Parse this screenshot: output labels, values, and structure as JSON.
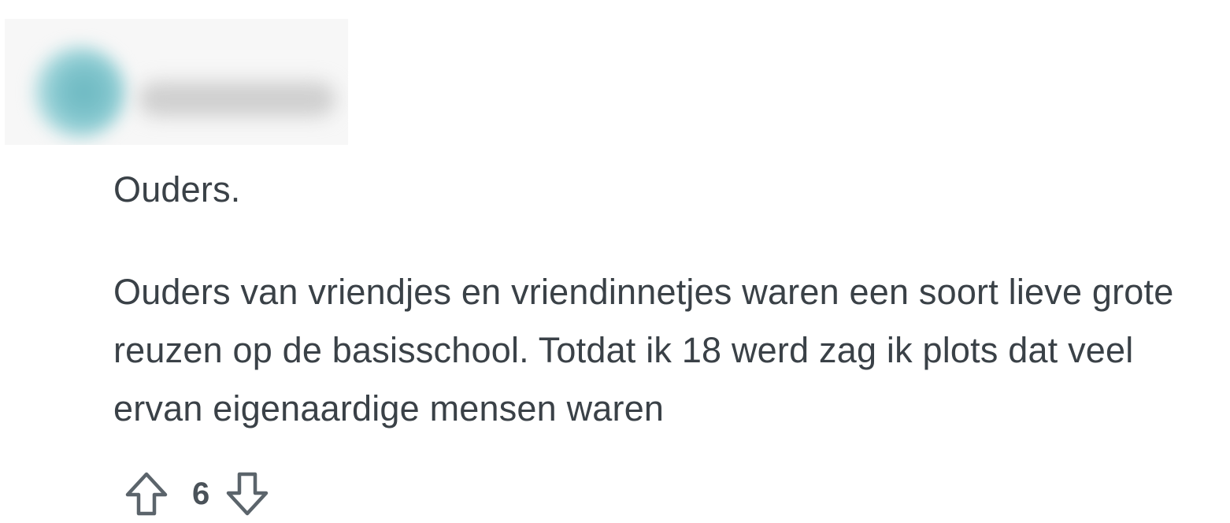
{
  "author": {
    "avatar": "blurred-avatar",
    "username": ""
  },
  "comment": {
    "paragraphs": [
      "Ouders.",
      "Ouders van vriendjes en vriendinnetjes waren een soort lieve grote reuzen op de basisschool. Totdat ik 18 werd zag ik plots dat veel ervan eigenaardige mensen waren"
    ]
  },
  "votes": {
    "count": "6",
    "upvote_icon": "arrow-up-outline-icon",
    "downvote_icon": "arrow-down-outline-icon"
  },
  "colors": {
    "text": "#3a4147",
    "icon": "#5b646b",
    "avatar_accent": "#6ab7c0"
  }
}
